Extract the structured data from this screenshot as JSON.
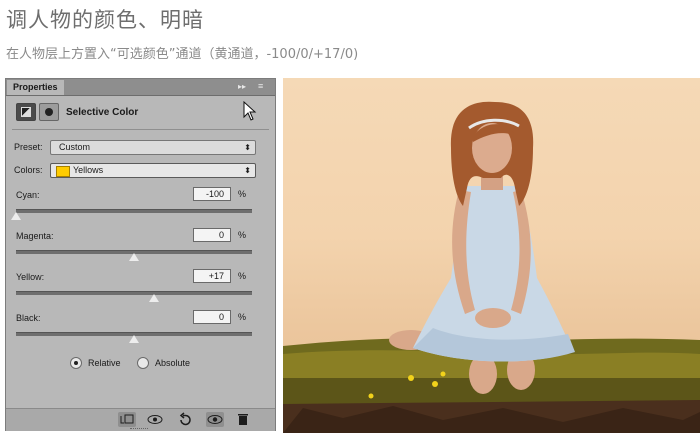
{
  "page": {
    "heading": "调人物的颜色、明暗",
    "subheading": "在人物层上方置入“可选颜色”通道（黄通道，-100/0/+17/0)"
  },
  "panel": {
    "tab_label": "Properties",
    "collapse_glyph": "▸▸",
    "menu_glyph": "≡",
    "adjustment_title": "Selective Color",
    "preset": {
      "label": "Preset:",
      "value": "Custom"
    },
    "colors": {
      "label": "Colors:",
      "value": "Yellows",
      "swatch_color": "#ffcc00"
    },
    "sliders": [
      {
        "label": "Cyan:",
        "value": "-100",
        "unit": "%",
        "amount": -100
      },
      {
        "label": "Magenta:",
        "value": "0",
        "unit": "%",
        "amount": 0
      },
      {
        "label": "Yellow:",
        "value": "+17",
        "unit": "%",
        "amount": 17
      },
      {
        "label": "Black:",
        "value": "0",
        "unit": "%",
        "amount": 0
      }
    ],
    "method": {
      "relative_label": "Relative",
      "absolute_label": "Absolute",
      "selected": "Relative"
    },
    "bottom_icons": [
      "clip-to-layer-icon",
      "view-previous-icon",
      "reset-icon",
      "visibility-icon",
      "trash-icon"
    ]
  },
  "photo": {
    "description_icon": "photo-canvas"
  }
}
